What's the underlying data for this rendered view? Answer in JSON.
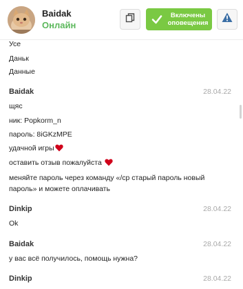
{
  "header": {
    "user_name": "Baidak",
    "user_status": "Онлайн",
    "notify_label": "Включены оповещения"
  },
  "messages": [
    {
      "lines": [
        "Усе",
        "Даньк",
        "Данные"
      ]
    },
    {
      "sender": "Baidak",
      "date": "28.04.22",
      "lines": [
        "щяс",
        "ник: Popkorm_n",
        "пароль: 8iGKzMPE",
        "удачной игры",
        "оставить отзыв пожалуйста",
        "меняйте пароль через команду «/cp старый пароль новый",
        "пароль» и можете оплачивать"
      ]
    },
    {
      "sender": "Dinkip",
      "date": "28.04.22",
      "lines": [
        "Ok"
      ]
    },
    {
      "sender": "Baidak",
      "date": "28.04.22",
      "lines": [
        "у вас всё получилось, помощь нужна?"
      ]
    },
    {
      "sender": "Dinkip",
      "date": "28.04.22",
      "lines": []
    }
  ],
  "icons": {
    "copy": "copy-icon",
    "check": "check-icon",
    "warning": "warning-icon",
    "heart": "heart-icon"
  },
  "colors": {
    "online": "#5cb85c",
    "notify_bg": "#7ac943",
    "warning": "#3a6ea5",
    "heart": "#d0021b",
    "date": "#a8a8a8"
  }
}
